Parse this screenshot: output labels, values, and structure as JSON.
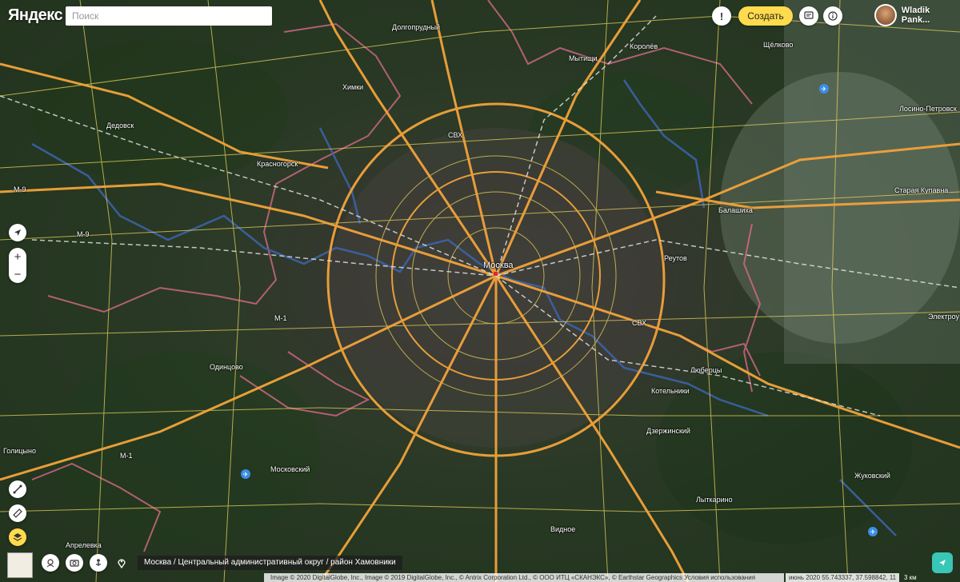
{
  "app": {
    "logo": "Яндекс"
  },
  "search": {
    "placeholder": "Поиск"
  },
  "header": {
    "create_label": "Создать",
    "user_name": "Wladik Pank..."
  },
  "icons": {
    "alert": "exclamation-icon",
    "messages": "chat-icon",
    "info": "info-icon",
    "navigate": "navigation-arrow-icon",
    "zoom_in": "plus-icon",
    "zoom_out": "minus-icon",
    "ruler": "ruler-icon",
    "layers": "layers-icon",
    "routes": "route-icon",
    "panorama": "panorama-icon",
    "photo": "camera-icon",
    "transport": "transport-icon",
    "place": "pin-icon",
    "share": "share-icon"
  },
  "map": {
    "cities": [
      {
        "name": "Москва",
        "big": true
      },
      {
        "name": "Химки"
      },
      {
        "name": "Долгопрудный"
      },
      {
        "name": "Мытищи"
      },
      {
        "name": "Королёв"
      },
      {
        "name": "Щёлково"
      },
      {
        "name": "Лосино-Петровск"
      },
      {
        "name": "Дедовск"
      },
      {
        "name": "Красногорск"
      },
      {
        "name": "Балашиха"
      },
      {
        "name": "Старая Купавна"
      },
      {
        "name": "Реутов"
      },
      {
        "name": "Электроу"
      },
      {
        "name": "Одинцово"
      },
      {
        "name": "Люберцы"
      },
      {
        "name": "Котельники"
      },
      {
        "name": "Дзержинский"
      },
      {
        "name": "Голицыно"
      },
      {
        "name": "Московский"
      },
      {
        "name": "Жуковский"
      },
      {
        "name": "Лыткарино"
      },
      {
        "name": "Видное"
      },
      {
        "name": "Апрелевка"
      }
    ],
    "road_labels": [
      "M-9",
      "M-9",
      "M-1",
      "M-1",
      "СВХ",
      "СВХ"
    ]
  },
  "breadcrumb": "Москва / Центральный административный округ / район Хамовники",
  "footer": {
    "copyright": "Image © 2020 DigitalGlobe, Inc., Image © 2019 DigitalGlobe, Inc., © Antrix Corporation Ltd., © ООО ИТЦ «СКАНЭКС», © Earthstar Geographics Условия использования",
    "coords": "июнь 2020  55.743337, 37.598842, 11",
    "scale": "3 км"
  },
  "colors": {
    "create_button": "#ffdb4d",
    "road_major": "#f2a33a",
    "road_minor": "#e8d25a",
    "boundary": "#d46a86",
    "water": "#3b63a8"
  }
}
